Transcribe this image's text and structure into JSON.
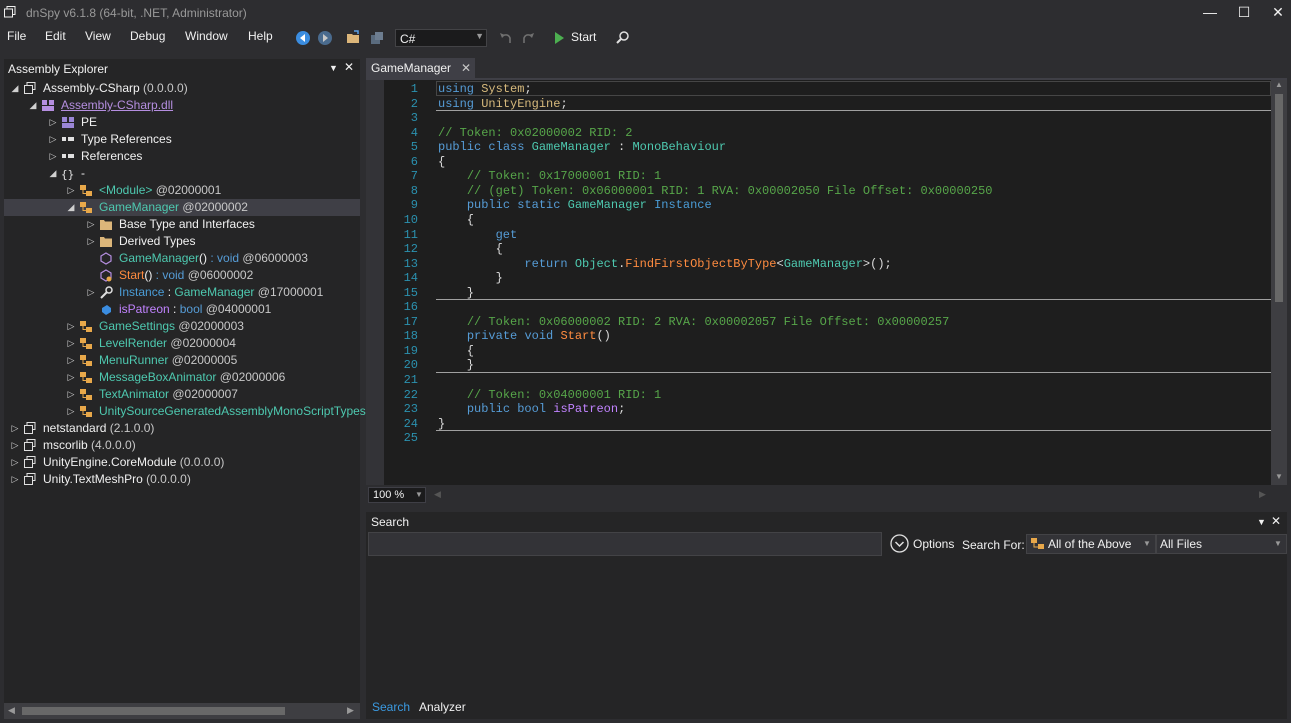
{
  "window": {
    "title": "dnSpy v6.1.8 (64-bit, .NET, Administrator)",
    "controls": {
      "minimize": "—",
      "maximize": "☐",
      "close": "✕"
    }
  },
  "menu": [
    "File",
    "Edit",
    "View",
    "Debug",
    "Window",
    "Help"
  ],
  "toolbar": {
    "language": "C#",
    "start_label": "Start"
  },
  "explorer": {
    "title": "Assembly Explorer",
    "nodes": [
      {
        "text": "Assembly-CSharp",
        "meta": " (0.0.0.0)",
        "icon": "assembly-icon",
        "level": 0,
        "expander": "open"
      },
      {
        "text": "Assembly-CSharp.dll",
        "meta": "",
        "icon": "module-icon",
        "level": 1,
        "expander": "open",
        "cls": "c-mod",
        "underline": true
      },
      {
        "text": "PE",
        "meta": "",
        "icon": "pe-icon",
        "level": 2,
        "expander": "closed"
      },
      {
        "text": "Type References",
        "meta": "",
        "icon": "references-icon",
        "level": 2,
        "expander": "closed"
      },
      {
        "text": "References",
        "meta": "",
        "icon": "references-icon",
        "level": 2,
        "expander": "closed"
      },
      {
        "text": "-",
        "meta": "",
        "icon": "namespace-icon",
        "level": 2,
        "expander": "open"
      },
      {
        "text": "<Module>",
        "meta": " @02000001",
        "icon": "class-icon",
        "level": 3,
        "expander": "closed",
        "cls": "c-type"
      },
      {
        "text": "GameManager",
        "meta": " @02000002",
        "icon": "class-icon",
        "level": 3,
        "expander": "open",
        "cls": "c-type",
        "selected": true
      },
      {
        "text": "Base Type and Interfaces",
        "meta": "",
        "icon": "folder-icon",
        "level": 4,
        "expander": "closed"
      },
      {
        "text": "Derived Types",
        "meta": "",
        "icon": "folder-icon",
        "level": 4,
        "expander": "closed"
      },
      {
        "text": "GameManager",
        "sig": "()",
        "rtype": " : void",
        "meta": " @06000003",
        "icon": "constructor-icon",
        "level": 4,
        "expander": "none",
        "cls": "c-meth2"
      },
      {
        "text": "Start",
        "sig": "()",
        "rtype": " : void",
        "meta": " @06000002",
        "icon": "method-icon",
        "level": 4,
        "expander": "none",
        "cls": "c-meth"
      },
      {
        "text": "Instance",
        "sig": "",
        "rtype2": "GameManager",
        "meta": " @17000001",
        "icon": "property-icon",
        "level": 4,
        "expander": "closed",
        "cls": "c-prop"
      },
      {
        "text": "isPatreon",
        "sig": "",
        "rtype3": "bool",
        "meta": " @04000001",
        "icon": "field-icon",
        "level": 4,
        "expander": "none",
        "cls": "c-field"
      },
      {
        "text": "GameSettings",
        "meta": " @02000003",
        "icon": "class-icon",
        "level": 3,
        "expander": "closed",
        "cls": "c-type"
      },
      {
        "text": "LevelRender",
        "meta": " @02000004",
        "icon": "class-icon",
        "level": 3,
        "expander": "closed",
        "cls": "c-type"
      },
      {
        "text": "MenuRunner",
        "meta": " @02000005",
        "icon": "class-icon",
        "level": 3,
        "expander": "closed",
        "cls": "c-type"
      },
      {
        "text": "MessageBoxAnimator",
        "meta": " @02000006",
        "icon": "class-icon",
        "level": 3,
        "expander": "closed",
        "cls": "c-type"
      },
      {
        "text": "TextAnimator",
        "meta": " @02000007",
        "icon": "class-icon",
        "level": 3,
        "expander": "closed",
        "cls": "c-type"
      },
      {
        "text": "UnitySourceGeneratedAssemblyMonoScriptTypes",
        "meta": "",
        "icon": "class-icon",
        "level": 3,
        "expander": "closed",
        "cls": "c-type"
      },
      {
        "text": "netstandard",
        "meta": " (2.1.0.0)",
        "icon": "assembly-icon",
        "level": 0,
        "expander": "closed"
      },
      {
        "text": "mscorlib",
        "meta": " (4.0.0.0)",
        "icon": "assembly-icon",
        "level": 0,
        "expander": "closed"
      },
      {
        "text": "UnityEngine.CoreModule",
        "meta": " (0.0.0.0)",
        "icon": "assembly-icon",
        "level": 0,
        "expander": "closed"
      },
      {
        "text": "Unity.TextMeshPro",
        "meta": " (0.0.0.0)",
        "icon": "assembly-icon",
        "level": 0,
        "expander": "closed"
      }
    ]
  },
  "editor": {
    "tab_title": "GameManager",
    "zoom": "100 %",
    "lines": [
      [
        [
          "kw",
          "using"
        ],
        [
          "tx",
          " "
        ],
        [
          "ns",
          "System"
        ],
        [
          "tx",
          ";"
        ]
      ],
      [
        [
          "kw",
          "using"
        ],
        [
          "tx",
          " "
        ],
        [
          "ns",
          "UnityEngine"
        ],
        [
          "tx",
          ";"
        ]
      ],
      [],
      [
        [
          "cm",
          "// Token: 0x02000002 RID: 2"
        ]
      ],
      [
        [
          "kw",
          "public"
        ],
        [
          "tx",
          " "
        ],
        [
          "kw",
          "class"
        ],
        [
          "tx",
          " "
        ],
        [
          "ty",
          "GameManager"
        ],
        [
          "tx",
          " : "
        ],
        [
          "ty",
          "MonoBehaviour"
        ]
      ],
      [
        [
          "tx",
          "{"
        ]
      ],
      [
        [
          "tx",
          "    "
        ],
        [
          "cm",
          "// Token: 0x17000001 RID: 1"
        ]
      ],
      [
        [
          "tx",
          "    "
        ],
        [
          "cm",
          "// (get) Token: 0x06000001 RID: 1 RVA: 0x00002050 File Offset: 0x00000250"
        ]
      ],
      [
        [
          "tx",
          "    "
        ],
        [
          "kw",
          "public"
        ],
        [
          "tx",
          " "
        ],
        [
          "kw",
          "static"
        ],
        [
          "tx",
          " "
        ],
        [
          "ty",
          "GameManager"
        ],
        [
          "tx",
          " "
        ],
        [
          "pr",
          "Instance"
        ]
      ],
      [
        [
          "tx",
          "    {"
        ]
      ],
      [
        [
          "tx",
          "        "
        ],
        [
          "kw",
          "get"
        ]
      ],
      [
        [
          "tx",
          "        {"
        ]
      ],
      [
        [
          "tx",
          "            "
        ],
        [
          "kw",
          "return"
        ],
        [
          "tx",
          " "
        ],
        [
          "ty",
          "Object"
        ],
        [
          "tx",
          "."
        ],
        [
          "me",
          "FindFirstObjectByType"
        ],
        [
          "tx",
          "<"
        ],
        [
          "ty",
          "GameManager"
        ],
        [
          "tx",
          ">();"
        ]
      ],
      [
        [
          "tx",
          "        }"
        ]
      ],
      [
        [
          "tx",
          "    }"
        ]
      ],
      [],
      [
        [
          "tx",
          "    "
        ],
        [
          "cm",
          "// Token: 0x06000002 RID: 2 RVA: 0x00002057 File Offset: 0x00000257"
        ]
      ],
      [
        [
          "tx",
          "    "
        ],
        [
          "kw",
          "private"
        ],
        [
          "tx",
          " "
        ],
        [
          "kw",
          "void"
        ],
        [
          "tx",
          " "
        ],
        [
          "me",
          "Start"
        ],
        [
          "tx",
          "()"
        ]
      ],
      [
        [
          "tx",
          "    {"
        ]
      ],
      [
        [
          "tx",
          "    }"
        ]
      ],
      [],
      [
        [
          "tx",
          "    "
        ],
        [
          "cm",
          "// Token: 0x04000001 RID: 1"
        ]
      ],
      [
        [
          "tx",
          "    "
        ],
        [
          "kw",
          "public"
        ],
        [
          "tx",
          " "
        ],
        [
          "kw",
          "bool"
        ],
        [
          "tx",
          " "
        ],
        [
          "fd",
          "isPatreon"
        ],
        [
          "tx",
          ";"
        ]
      ],
      [
        [
          "tx",
          "}"
        ]
      ],
      []
    ]
  },
  "search": {
    "title": "Search",
    "input_value": "",
    "options_label": "Options",
    "search_for_label": "Search For:",
    "search_for_value": "All of the Above",
    "scope_value": "All Files",
    "tabs": [
      "Search",
      "Analyzer"
    ]
  }
}
